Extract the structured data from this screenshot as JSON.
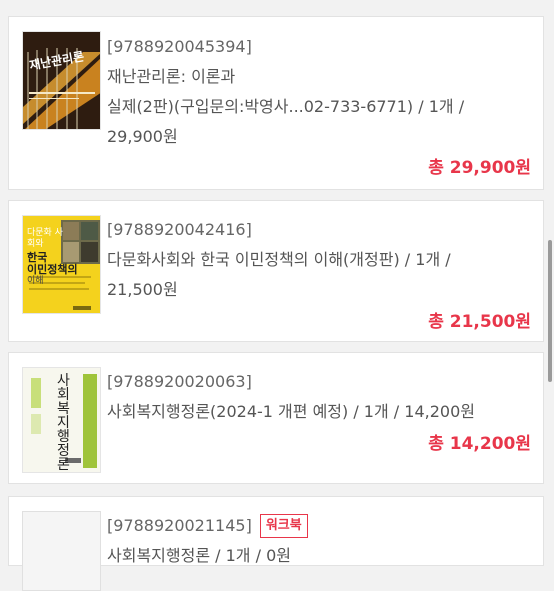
{
  "items": [
    {
      "isbn": "[9788920045394]",
      "desc_line1": "재난관리론: 이론과",
      "desc_line2": "실제(2판)(구입문의:박영사...02-733-6771) / 1개 /",
      "desc_line3": "29,900원",
      "total": "총 29,900원",
      "cover_title": "재난관리론"
    },
    {
      "isbn": "[9788920042416]",
      "desc_line1": "다문화사회와 한국 이민정책의 이해(개정판) / 1개 /",
      "desc_line2": "21,500원",
      "total": "총 21,500원",
      "cover_top": "다문화 사회와",
      "cover_title_1": "한국",
      "cover_title_2": "이민정책의",
      "cover_title_3": "이해"
    },
    {
      "isbn": "[9788920020063]",
      "desc_line1": "사회복지행정론(2024-1 개편 예정) / 1개 / 14,200원",
      "total": "총 14,200원",
      "cover_title": "사회복지행정론"
    },
    {
      "isbn": "[9788920021145]",
      "badge": "워크북",
      "desc_line1": "사회복지행정론 / 1개 / 0원"
    }
  ]
}
